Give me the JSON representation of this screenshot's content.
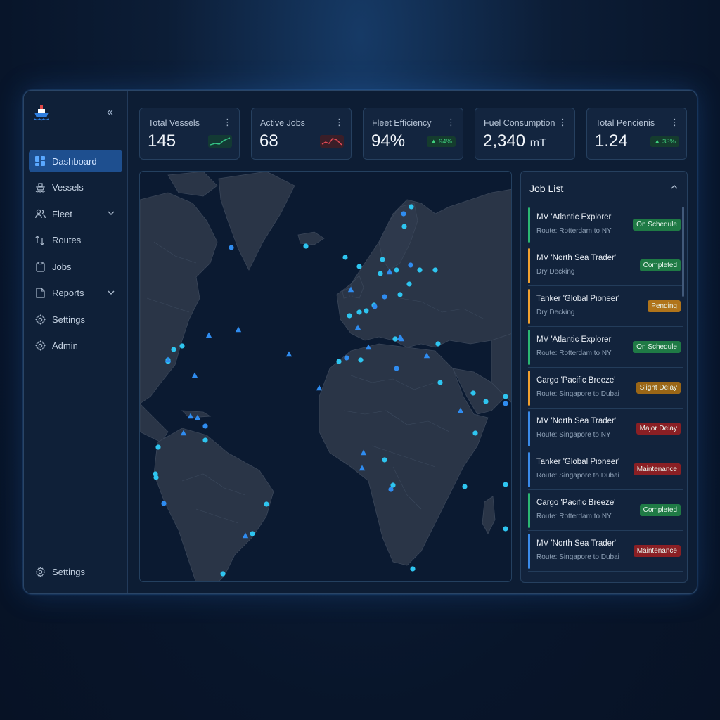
{
  "sidebar": {
    "items": [
      {
        "label": "Dashboard",
        "icon": "dashboard-icon",
        "active": true
      },
      {
        "label": "Vessels",
        "icon": "ship-icon"
      },
      {
        "label": "Fleet",
        "icon": "users-icon",
        "expandable": true
      },
      {
        "label": "Routes",
        "icon": "route-icon"
      },
      {
        "label": "Jobs",
        "icon": "clipboard-icon"
      },
      {
        "label": "Reports",
        "icon": "document-icon",
        "expandable": true
      },
      {
        "label": "Settings",
        "icon": "gear-icon"
      },
      {
        "label": "Admin",
        "icon": "admin-gear-icon"
      }
    ],
    "bottom": {
      "label": "Settings",
      "icon": "gear-icon"
    }
  },
  "kpis": [
    {
      "label": "Total Vessels",
      "value": "145",
      "indicator": "sparkline-up"
    },
    {
      "label": "Active Jobs",
      "value": "68",
      "indicator": "sparkline-down"
    },
    {
      "label": "Fleet Efficiency",
      "value": "94%",
      "badge": "▲ 94%"
    },
    {
      "label": "Fuel Consumption",
      "value": "2,340",
      "unit": "mT"
    },
    {
      "label": "Total Pencienis",
      "value": "1.24",
      "badge": "▲ 33%"
    }
  ],
  "jobs": {
    "title": "Job List",
    "items": [
      {
        "name": "MV 'Atlantic Explorer'",
        "sub": "Route: Rotterdam to NY",
        "status": "On Schedule",
        "bar": "#2bb673",
        "statusColor": "#1f7a45"
      },
      {
        "name": "MV 'North Sea Trader'",
        "sub": "Dry Decking",
        "status": "Completed",
        "bar": "#f0a030",
        "statusColor": "#1f7a45"
      },
      {
        "name": "Tanker 'Global Pioneer'",
        "sub": "Dry Decking",
        "status": "Pending",
        "bar": "#f0a030",
        "statusColor": "#b0741a"
      },
      {
        "name": "MV 'Atlantic Explorer'",
        "sub": "Route: Rotterdam to NY",
        "status": "On Schedule",
        "bar": "#2bb673",
        "statusColor": "#1f7a45"
      },
      {
        "name": "Cargo 'Pacific Breeze'",
        "sub": "Route: Singapore to Dubai",
        "status": "Slight Delay",
        "bar": "#f0a030",
        "statusColor": "#9a6616"
      },
      {
        "name": "MV 'North Sea Trader'",
        "sub": "Route: Singapore to NY",
        "status": "Major Delay",
        "bar": "#3a8ae8",
        "statusColor": "#8a1f24"
      },
      {
        "name": "Tanker 'Global Pioneer'",
        "sub": "Route: Singapore to Dubai",
        "status": "Maintenance",
        "bar": "#3a8ae8",
        "statusColor": "#8a1f24"
      },
      {
        "name": "Cargo 'Pacific Breeze'",
        "sub": "Route: Rotterdam to NY",
        "status": "Completed",
        "bar": "#2bb673",
        "statusColor": "#1f7a45"
      },
      {
        "name": "MV 'North Sea Trader'",
        "sub": "Route: Singapore to Dubai",
        "status": "Maintenance",
        "bar": "#3a8ae8",
        "statusColor": "#8a1f24"
      }
    ]
  },
  "colors": {
    "accent": "#1e4f8f",
    "vessel_marker": "#2ec5f0",
    "vessel_marker_alt": "#2f8cf0",
    "land": "#2a3547",
    "ocean": "#0b1a31"
  }
}
